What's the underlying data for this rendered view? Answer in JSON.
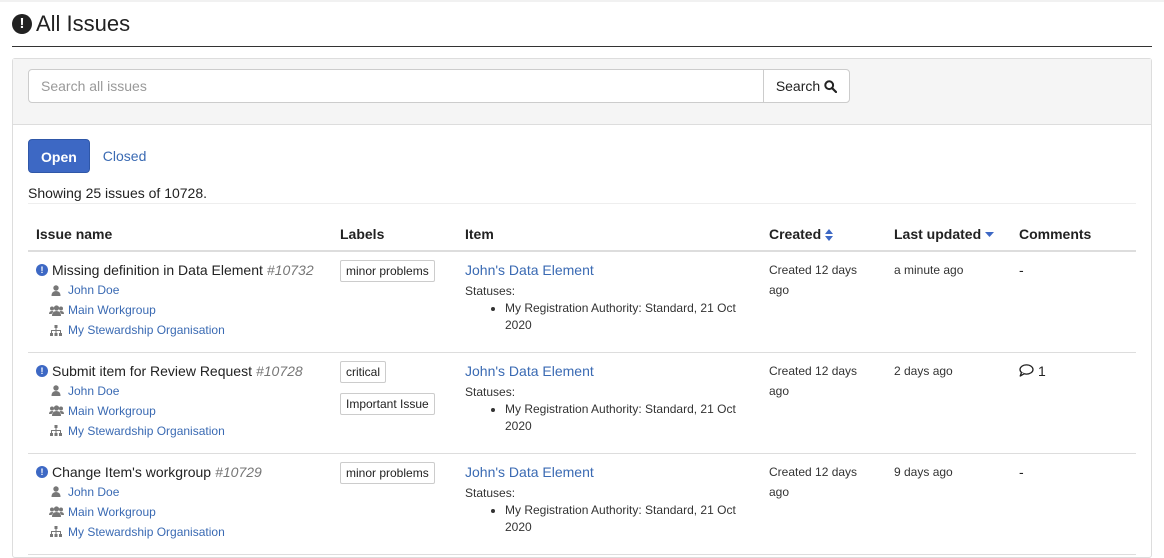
{
  "page": {
    "title": "All Issues"
  },
  "search": {
    "placeholder": "Search all issues",
    "button_label": "Search"
  },
  "tabs": [
    {
      "label": "Open",
      "active": true
    },
    {
      "label": "Closed",
      "active": false
    }
  ],
  "showing_text": "Showing 25 issues of 10728.",
  "columns": {
    "issue_name": "Issue name",
    "labels": "Labels",
    "item": "Item",
    "created": "Created",
    "last_updated": "Last updated",
    "comments": "Comments"
  },
  "issues": [
    {
      "title": "Missing definition in Data Element",
      "number": "#10732",
      "user": "John Doe",
      "workgroup": "Main Workgroup",
      "organisation": "My Stewardship Organisation",
      "labels": [
        "minor problems"
      ],
      "item": "John's Data Element",
      "statuses_label": "Statuses:",
      "status": "My Registration Authority: Standard, 21 Oct 2020",
      "created": "Created 12 days ago",
      "updated": "a minute ago",
      "comments": "-"
    },
    {
      "title": "Submit item for Review Request",
      "number": "#10728",
      "user": "John Doe",
      "workgroup": "Main Workgroup",
      "organisation": "My Stewardship Organisation",
      "labels": [
        "critical",
        "Important Issue"
      ],
      "item": "John's Data Element",
      "statuses_label": "Statuses:",
      "status": "My Registration Authority: Standard, 21 Oct 2020",
      "created": "Created 12 days ago",
      "updated": "2 days ago",
      "comments": "1"
    },
    {
      "title": "Change Item's workgroup",
      "number": "#10729",
      "user": "John Doe",
      "workgroup": "Main Workgroup",
      "organisation": "My Stewardship Organisation",
      "labels": [
        "minor problems"
      ],
      "item": "John's Data Element",
      "statuses_label": "Statuses:",
      "status": "My Registration Authority: Standard, 21 Oct 2020",
      "created": "Created 12 days ago",
      "updated": "9 days ago",
      "comments": "-"
    }
  ],
  "colors": {
    "accent": "#3d68c4",
    "link": "#3a6ab3",
    "panel_head": "#f5f5f5"
  }
}
